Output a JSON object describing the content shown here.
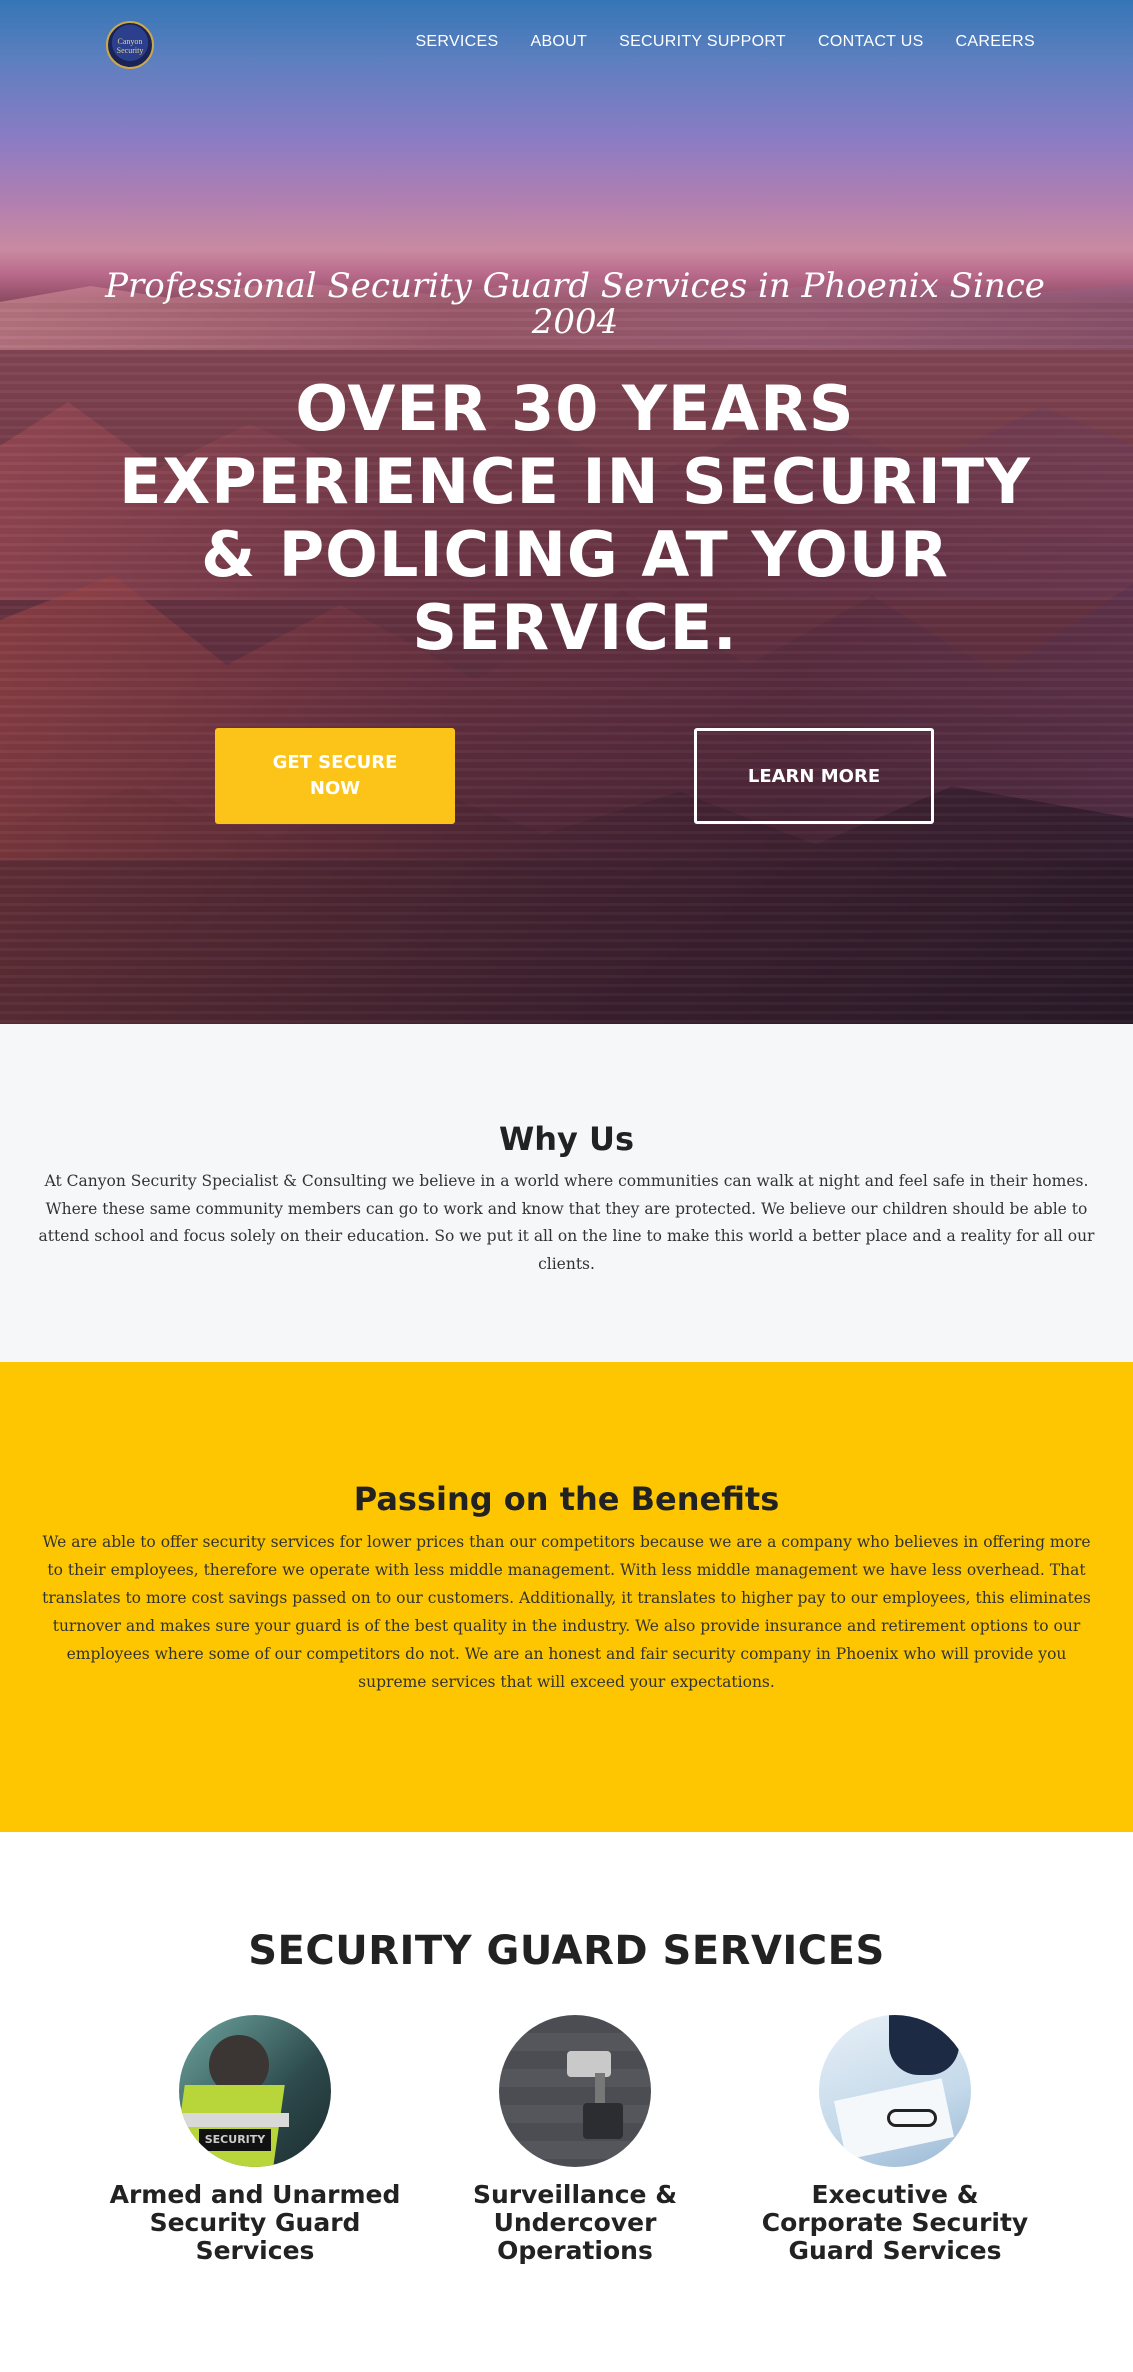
{
  "nav": {
    "logo_text": "Canyon Security",
    "items": [
      "SERVICES",
      "ABOUT",
      "SECURITY SUPPORT",
      "CONTACT US",
      "CAREERS"
    ]
  },
  "hero": {
    "tagline": "Professional Security Guard Services in Phoenix Since 2004",
    "headline": "OVER 30 YEARS EXPERIENCE IN SECURITY & POLICING AT YOUR SERVICE.",
    "primary_button": "GET SECURE NOW",
    "secondary_button": "LEARN MORE"
  },
  "why": {
    "title": "Why Us",
    "body": "At Canyon Security Specialist & Consulting we believe in a world where communities can walk at night and feel safe in their homes. Where these same community members can go to work and know that they are protected. We believe our children should be able to attend school and focus solely on their education. So we put it all on the line to make this world a better place and a reality for all our clients."
  },
  "benefits": {
    "title": "Passing on the Benefits",
    "body": "We are able to offer security services for lower prices than our competitors because we are a company who believes in offering more to their employees, therefore we operate with less middle management. With less middle management we have less overhead. That translates to more cost savings passed on to our customers. Additionally, it translates to higher pay to our employees, this eliminates turnover and makes sure your guard is of the best quality in the industry. We also provide insurance and retirement options to our employees where some of our competitors do not. We are an honest and fair security company in Phoenix who will provide you supreme services that will exceed your expectations."
  },
  "services": {
    "title": "SECURITY GUARD SERVICES",
    "items": [
      {
        "title": "Armed and Unarmed Security Guard Services",
        "image_text": "SECURITY"
      },
      {
        "title": "Surveillance & Undercover Operations"
      },
      {
        "title": "Executive & Corporate Security Guard Services"
      }
    ]
  },
  "colors": {
    "accent_yellow": "#fec601",
    "button_yellow": "#fcc419",
    "light_gray_bg": "#f6f7f9"
  }
}
